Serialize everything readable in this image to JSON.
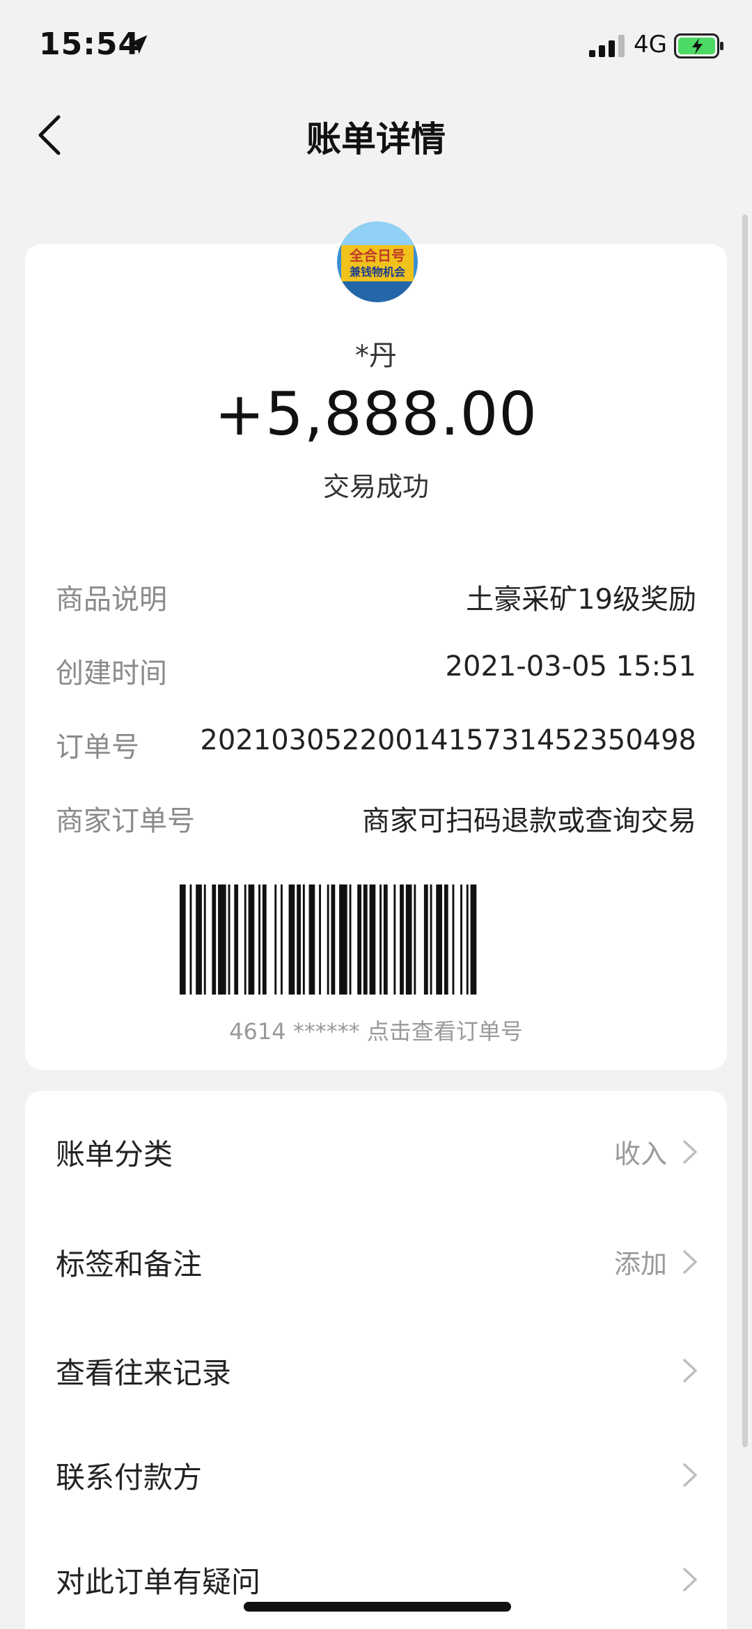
{
  "status_bar": {
    "time": "15:54",
    "network": "4G",
    "location_icon": "location-arrow-icon",
    "signal_icon": "cellular-signal-icon",
    "battery_icon": "battery-charging-icon",
    "battery_color": "#4cd964"
  },
  "nav": {
    "title": "账单详情",
    "back_icon": "chevron-left-icon"
  },
  "transaction": {
    "payer_name": "*丹",
    "amount": "+5,888.00",
    "status": "交易成功",
    "avatar_text": "全合日号 会兼钱物机会"
  },
  "details": [
    {
      "label": "商品说明",
      "value": "土豪采矿19级奖励"
    },
    {
      "label": "创建时间",
      "value": "2021-03-05 15:51"
    },
    {
      "label": "订单号",
      "value": "2021030522001415731452350498"
    },
    {
      "label": "商家订单号",
      "value": "商家可扫码退款或查询交易"
    }
  ],
  "barcode": {
    "caption": "4614 ****** 点击查看订单号"
  },
  "menu": [
    {
      "label": "账单分类",
      "value": "收入"
    },
    {
      "label": "标签和备注",
      "value": "添加"
    },
    {
      "label": "查看往来记录",
      "value": ""
    },
    {
      "label": "联系付款方",
      "value": ""
    },
    {
      "label": "对此订单有疑问",
      "value": ""
    }
  ],
  "colors": {
    "background": "#f2f2f2",
    "card": "#ffffff",
    "label_gray": "#8a8a8a",
    "text": "#222222"
  }
}
